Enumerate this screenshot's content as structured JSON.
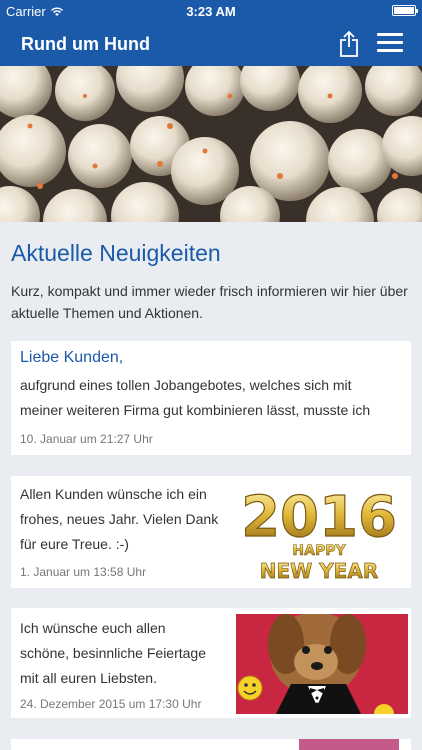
{
  "status": {
    "carrier": "Carrier",
    "time": "3:23 AM"
  },
  "nav": {
    "title": "Rund um Hund"
  },
  "section": {
    "title": "Aktuelle Neuigkeiten",
    "intro": "Kurz, kompakt und immer wieder frisch informieren wir hier über aktuelle Themen und Aktionen."
  },
  "news": [
    {
      "title": "Liebe Kunden,",
      "text_lines": [
        "aufgrund eines tollen Jobangebotes, welches sich mit",
        "meiner weiteren Firma gut kombinieren lässt, musste ich"
      ],
      "date": "10. Januar um 21:27 Uhr"
    },
    {
      "text_lines": [
        "Allen Kunden wünsche ich ein",
        "frohes, neues Jahr. Vielen Dank",
        "für eure Treue. :-)"
      ],
      "date": "1. Januar um 13:58 Uhr",
      "image": {
        "year": "2016",
        "line1": "HAPPY",
        "line2": "NEW YEAR"
      }
    },
    {
      "text_lines": [
        "Ich wünsche euch allen",
        "schöne, besinnliche Feiertage",
        "mit all euren Liebsten."
      ],
      "date": "24. Dezember 2015 um 17:30 Uhr"
    }
  ]
}
